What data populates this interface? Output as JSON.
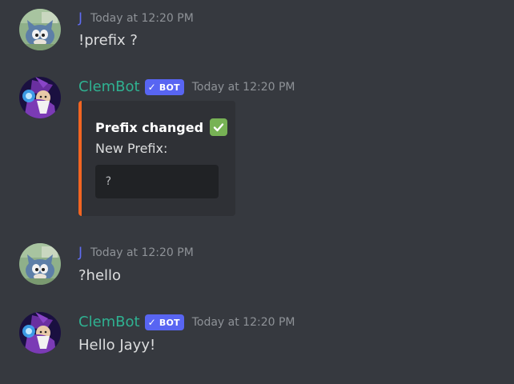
{
  "messages": [
    {
      "username": "J",
      "timestamp": "Today at 12:20 PM",
      "content": "!prefix ?"
    },
    {
      "username": "ClemBot",
      "badge": "BOT",
      "timestamp": "Today at 12:20 PM",
      "embed": {
        "title": "Prefix changed",
        "title_emoji": "white-check-mark",
        "field_name": "New Prefix:",
        "field_value": "?",
        "accent_color": "#f26522"
      }
    },
    {
      "username": "J",
      "timestamp": "Today at 12:20 PM",
      "content": "?hello"
    },
    {
      "username": "ClemBot",
      "badge": "BOT",
      "timestamp": "Today at 12:20 PM",
      "content": "Hello Jayy!"
    }
  ],
  "colors": {
    "background": "#36393f",
    "user_name_color": "#5f6cf2",
    "bot_name_color": "#2fb191",
    "bot_badge": "#5865f2",
    "timestamp": "#8e9297",
    "text": "#dcddde",
    "embed_background": "#2f3136",
    "code_background": "#202225"
  },
  "icons": {
    "user_avatar": "cartoon-cat-avatar",
    "bot_avatar": "wizard-avatar",
    "badge_check": "verified-check-icon"
  }
}
